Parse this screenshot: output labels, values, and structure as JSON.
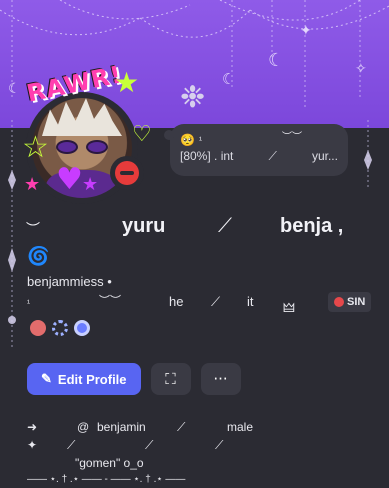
{
  "banner": {
    "decorations": [
      "☾",
      "✦",
      "☾",
      "✧",
      "☾",
      "❉"
    ]
  },
  "avatar": {
    "sticker_text": "RAWR!",
    "status": "do-not-disturb"
  },
  "custom_status": {
    "emoji": "🥺",
    "superscript": "¹",
    "percent": "[80%]",
    "tag": ". int",
    "decor": "︶︶",
    "slash": "⟋",
    "name": "yur..."
  },
  "display_name": {
    "decor_left": "︶",
    "part1": "yuru",
    "slash": "⟋",
    "part2": "benja ,"
  },
  "spiral": "🌀",
  "username": "benjammiess",
  "username_dot": "•",
  "pronouns": {
    "superscript": "¹",
    "decor": "︶︶",
    "he": "he",
    "slash": "⟋",
    "it": "it",
    "symbol": "🜲",
    "tag_label": "SIN"
  },
  "badge_colors": [
    "#e26c6c",
    "#9db0ff",
    "#6a7cff"
  ],
  "actions": {
    "edit_profile": "Edit Profile",
    "edit_icon": "✎",
    "gift_icon": "⛶",
    "more_icon": "···"
  },
  "bio": {
    "line1": {
      "arrow": "➜",
      "at": "@",
      "name": "benjamin",
      "slash": "⟋",
      "gender": "male"
    },
    "line2": {
      "sparkle": "✦",
      "slash1": "⟋",
      "slash2": "⟋",
      "slash3": "⟋"
    },
    "line3": "\"gomen\" o_o",
    "line4": "—— ⋆. † .⋆ —— - —— ⋆. † .⋆ ——"
  },
  "colors": {
    "banner": "#8f5be8",
    "background": "#2b2b33",
    "accent": "#5865f2",
    "dnd": "#e63b3b"
  }
}
